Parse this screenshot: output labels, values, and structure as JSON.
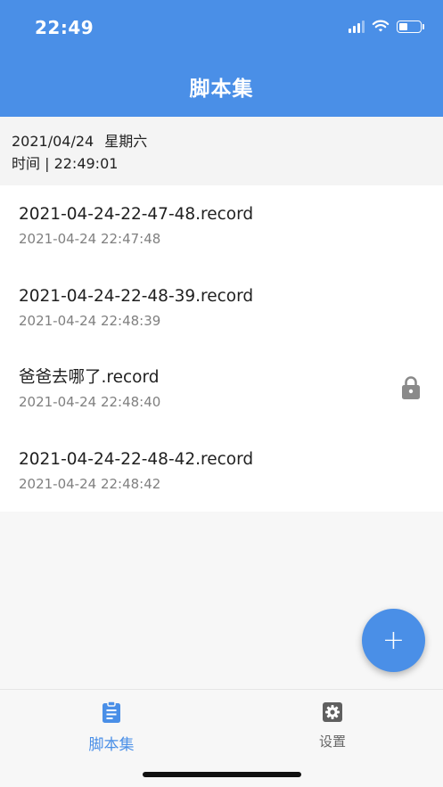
{
  "status_bar": {
    "time": "22:49",
    "signal_icon": "signal-icon",
    "wifi_icon": "wifi-icon",
    "battery_icon": "battery-icon"
  },
  "header": {
    "title": "脚本集"
  },
  "date_panel": {
    "date": "2021/04/24",
    "weekday": "星期六",
    "time_line": "时间 | 22:49:01"
  },
  "records": [
    {
      "name": "2021-04-24-22-47-48.record",
      "date": "2021-04-24 22:47:48",
      "locked": false
    },
    {
      "name": "2021-04-24-22-48-39.record",
      "date": "2021-04-24 22:48:39",
      "locked": false
    },
    {
      "name": "爸爸去哪了.record",
      "date": "2021-04-24 22:48:40",
      "locked": true
    },
    {
      "name": "2021-04-24-22-48-42.record",
      "date": "2021-04-24 22:48:42",
      "locked": false
    }
  ],
  "fab": {
    "label": "+",
    "icon": "plus-icon"
  },
  "tabs": [
    {
      "label": "脚本集",
      "icon": "clipboard-icon",
      "active": true
    },
    {
      "label": "设置",
      "icon": "gear-icon",
      "active": false
    }
  ],
  "colors": {
    "primary": "#4a8fe7",
    "text": "#1f1f1f",
    "subtext": "#808080",
    "inactive": "#666666"
  }
}
